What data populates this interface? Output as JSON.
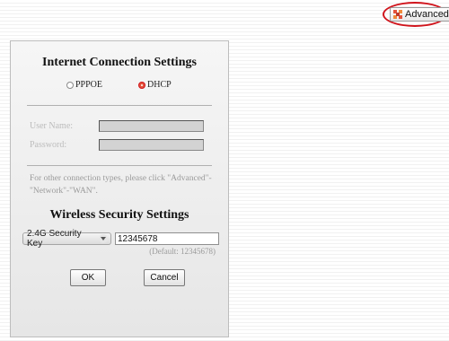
{
  "header": {
    "advanced_label": "Advanced",
    "advanced_icon": "settings-grid-icon",
    "highlight_color": "#d0141c"
  },
  "internet": {
    "title": "Internet Connection Settings",
    "options": [
      {
        "label": "PPPOE",
        "selected": false
      },
      {
        "label": "DHCP",
        "selected": true
      }
    ],
    "username_label": "User Name:",
    "password_label": "Password:",
    "username_value": "",
    "password_value": "",
    "hint": "For other connection types, please click \"Advanced\"-\"Network\"-\"WAN\"."
  },
  "wireless": {
    "title": "Wireless Security Settings",
    "key_type": "2.4G Security Key",
    "key_value": "12345678",
    "default_note": "(Default: 12345678)"
  },
  "buttons": {
    "ok": "OK",
    "cancel": "Cancel"
  },
  "accent_color": "#e4533c"
}
